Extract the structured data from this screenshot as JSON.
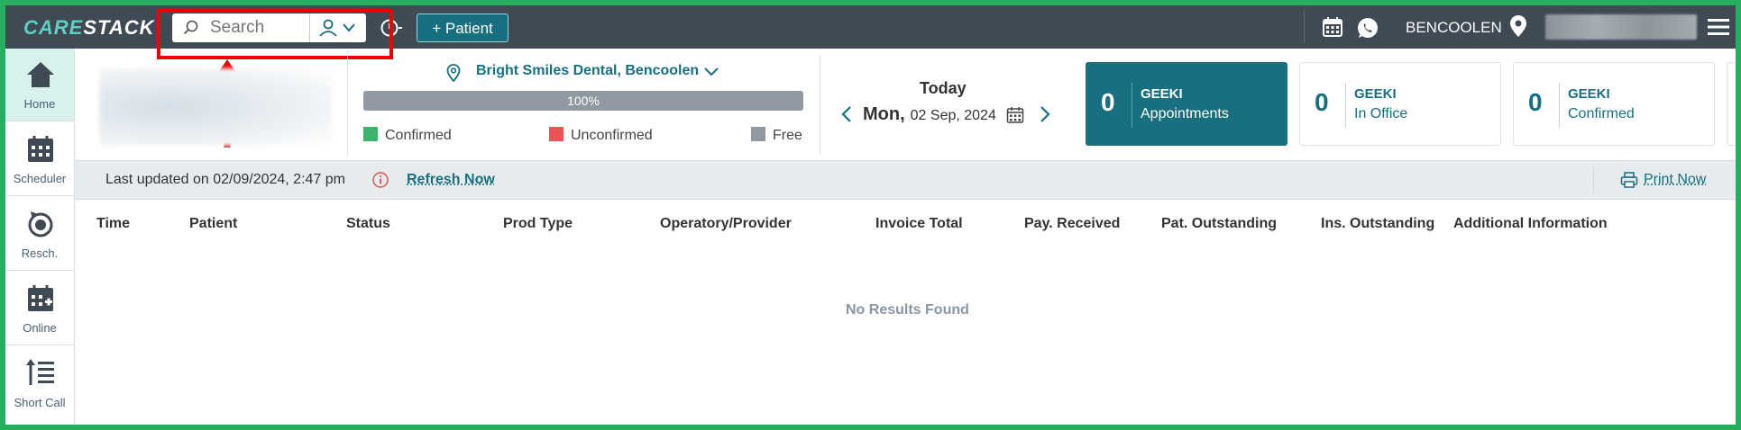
{
  "app": {
    "logo_text_part1": "CARE",
    "logo_text_part2": "STACK"
  },
  "topbar": {
    "search_placeholder": "Search",
    "add_patient_label": "+ Patient",
    "location_label": "BENCOOLEN"
  },
  "sidebar": {
    "items": [
      {
        "label": "Home"
      },
      {
        "label": "Scheduler"
      },
      {
        "label": "Resch."
      },
      {
        "label": "Online"
      },
      {
        "label": "Short Call"
      }
    ]
  },
  "summary": {
    "clinic_name": "Bright Smiles Dental, Bencoolen",
    "progress_value": 100,
    "progress_label": "100%",
    "legend": [
      {
        "label": "Confirmed",
        "color": "#3cb46e"
      },
      {
        "label": "Unconfirmed",
        "color": "#e85454"
      },
      {
        "label": "Free",
        "color": "#919aa3"
      }
    ],
    "today_label": "Today",
    "weekday": "Mon,",
    "date": "02 Sep, 2024"
  },
  "cards": [
    {
      "count": "0",
      "title": "GEEKI",
      "subtitle": "Appointments",
      "active": true
    },
    {
      "count": "0",
      "title": "GEEKI",
      "subtitle": "In Office",
      "active": false
    },
    {
      "count": "0",
      "title": "GEEKI",
      "subtitle": "Confirmed",
      "active": false
    }
  ],
  "status_bar": {
    "last_updated": "Last updated on 02/09/2024, 2:47 pm",
    "refresh_label": "Refresh Now",
    "print_label": "Print Now"
  },
  "table": {
    "headers": [
      "Time",
      "Patient",
      "Status",
      "Prod Type",
      "Operatory/Provider",
      "Invoice Total",
      "Pay. Received",
      "Pat. Outstanding",
      "Ins. Outstanding",
      "Additional Information"
    ],
    "empty_message": "No Results Found"
  },
  "colors": {
    "accent": "#176f80",
    "topbar": "#3f4a54",
    "highlight": "#e00000",
    "frame": "#27ae60"
  }
}
